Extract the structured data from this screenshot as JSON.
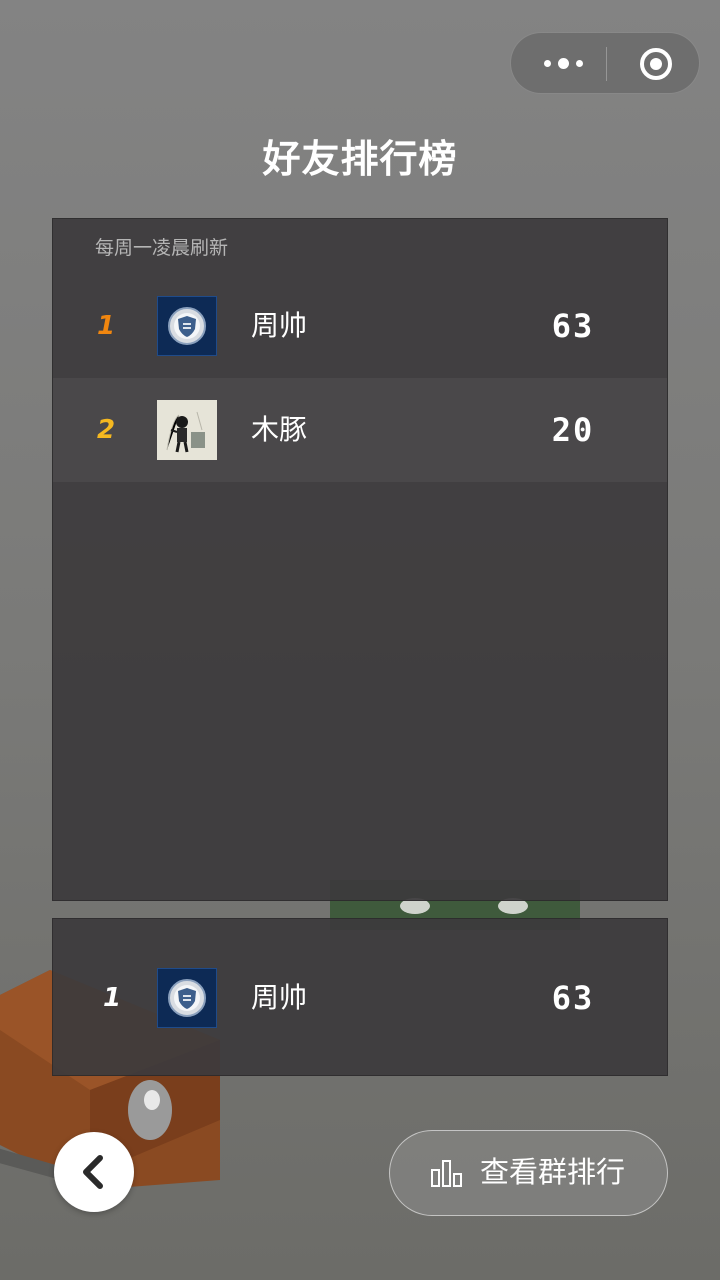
{
  "capsule": {
    "more_icon": "more-dots-icon",
    "close_icon": "target-circle-icon"
  },
  "title": "好友排行榜",
  "leaderboard": {
    "note": "每周一凌晨刷新",
    "rows": [
      {
        "rank": "1",
        "name": "周帅",
        "score": "63",
        "rank_color": "#f0860f",
        "avatar": "shield-badge-avatar"
      },
      {
        "rank": "2",
        "name": "木豚",
        "score": "20",
        "rank_color": "#f5b820",
        "avatar": "sketch-figure-avatar"
      }
    ]
  },
  "my_rank": {
    "rank": "1",
    "name": "周帅",
    "score": "63",
    "rank_color": "#ffffff",
    "avatar": "shield-badge-avatar"
  },
  "buttons": {
    "back_icon": "chevron-left-icon",
    "group_rank_label": "查看群排行",
    "group_rank_icon": "bar-chart-icon"
  }
}
